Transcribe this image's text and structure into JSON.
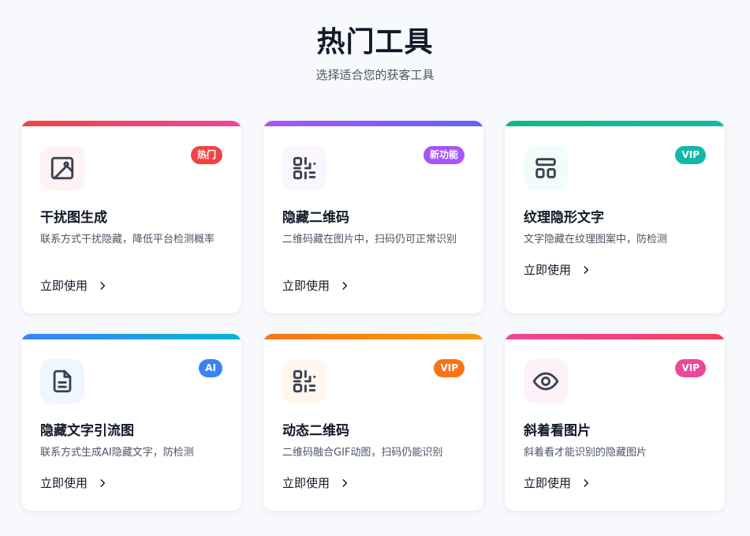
{
  "header": {
    "title": "热门工具",
    "subtitle": "选择适合您的获客工具"
  },
  "cards": [
    {
      "name": "干扰图生成",
      "description": "联系方式干扰隐藏，降低平台检测概率",
      "badge": "热门",
      "cta": "立即使用",
      "icon": "image-icon",
      "bar_gradient": [
        "#ef4444",
        "#ec4899"
      ],
      "badge_color": "#ef4444",
      "icon_bg": "#fef2f2"
    },
    {
      "name": "隐藏二维码",
      "description": "二维码藏在图片中，扫码仍可正常识别",
      "badge": "新功能",
      "cta": "立即使用",
      "icon": "qr-code-icon",
      "bar_gradient": [
        "#a855f7",
        "#6366f1"
      ],
      "badge_color": "#a855f7",
      "icon_bg": "#faf5ff"
    },
    {
      "name": "纹理隐形文字",
      "description": "文字隐藏在纹理图案中，防检测",
      "badge": "VIP",
      "cta": "立即使用",
      "icon": "layout-icon",
      "bar_gradient": [
        "#10b981",
        "#14b8a6"
      ],
      "badge_color": "#14b8a6",
      "icon_bg": "#f0fdfa"
    },
    {
      "name": "隐藏文字引流图",
      "description": "联系方式生成AI隐藏文字，防检测",
      "badge": "AI",
      "cta": "立即使用",
      "icon": "document-icon",
      "bar_gradient": [
        "#3b82f6",
        "#06b6d4"
      ],
      "badge_color": "#3b82f6",
      "icon_bg": "#eff6ff"
    },
    {
      "name": "动态二维码",
      "description": "二维码融合GIF动图，扫码仍能识别",
      "badge": "VIP",
      "cta": "立即使用",
      "icon": "qr-code-icon",
      "bar_gradient": [
        "#f97316",
        "#f59e0b"
      ],
      "badge_color": "#f97316",
      "icon_bg": "#fff7ed"
    },
    {
      "name": "斜着看图片",
      "description": "斜着看才能识别的隐藏图片",
      "badge": "VIP",
      "cta": "立即使用",
      "icon": "eye-icon",
      "bar_gradient": [
        "#ec4899",
        "#f43f5e"
      ],
      "badge_color": "#ec4899",
      "icon_bg": "#fdf2f8"
    }
  ]
}
